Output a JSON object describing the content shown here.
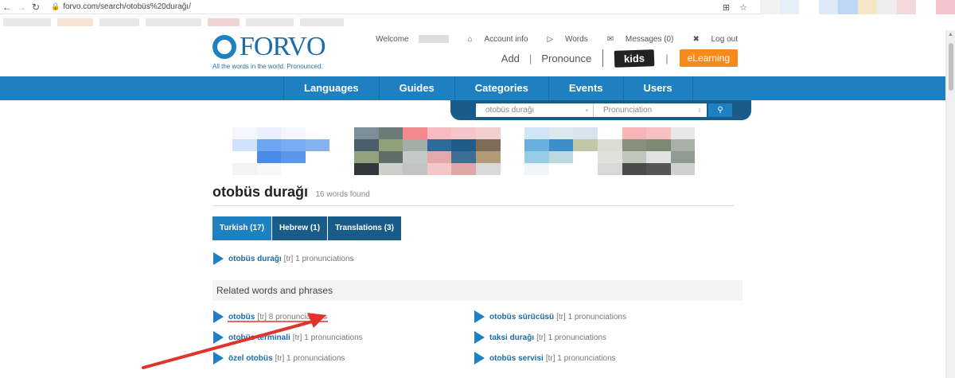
{
  "browser": {
    "url": "forvo.com/search/otobüs%20durağı/"
  },
  "header": {
    "logo_text": "FORVO",
    "tagline": "All the words in the world. Pronounced.",
    "welcome": "Welcome",
    "account_info": "Account info",
    "words": "Words",
    "messages": "Messages (0)",
    "log_out": "Log out",
    "add": "Add",
    "pronounce": "Pronounce",
    "kids": "kids",
    "elearning": "eLearning"
  },
  "nav": {
    "items": [
      "Languages",
      "Guides",
      "Categories",
      "Events",
      "Users"
    ]
  },
  "search": {
    "query": "otobüs durağı",
    "type": "Pronunciation"
  },
  "result": {
    "title": "otobüs durağı",
    "count": "16 words found"
  },
  "tabs": [
    "Turkish (17)",
    "Hebrew (1)",
    "Translations (3)"
  ],
  "main_entry": {
    "word": "otobüs durağı",
    "lang": "[tr]",
    "pron": "1 pronunciations"
  },
  "related": {
    "heading": "Related words and phrases",
    "left": [
      {
        "word": "otobüs",
        "lang": "[tr]",
        "pron": "8 pronunciations"
      },
      {
        "word": "otobüs terminali",
        "lang": "[tr]",
        "pron": "1 pronunciations"
      },
      {
        "word": "özel otobüs",
        "lang": "[tr]",
        "pron": "1 pronunciations"
      }
    ],
    "right": [
      {
        "word": "otobüs sürücüsü",
        "lang": "[tr]",
        "pron": "1 pronunciations"
      },
      {
        "word": "taksi durağı",
        "lang": "[tr]",
        "pron": "1 pronunciations"
      },
      {
        "word": "otobüs servisi",
        "lang": "[tr]",
        "pron": "1 pronunciations"
      }
    ]
  },
  "colors": {
    "brand_blue": "#1e7fc1",
    "dark_blue": "#1a5c89",
    "elearning_orange": "#f78a1d",
    "annotation_red": "#e0332b"
  }
}
